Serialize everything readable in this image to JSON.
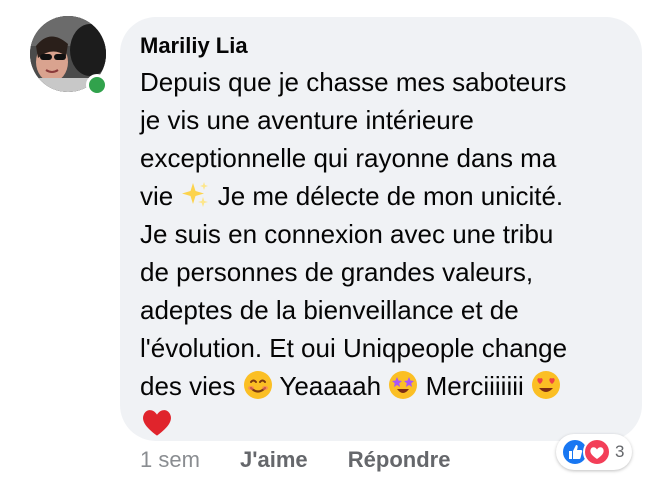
{
  "comment": {
    "author": "Mariliy Lia",
    "text_lines": [
      "Depuis que je chasse mes saboteurs",
      "je vis une aventure intérieure",
      "exceptionnelle qui rayonne dans ma",
      "vie",
      "Je me délecte de mon unicité.",
      "Je suis en connexion avec une tribu",
      "de personnes de grandes valeurs,",
      "adeptes de la bienveillance et de",
      "l'évolution. Et oui Uniqpeople change",
      "des vies",
      "Yeaaaah",
      "Merciiiiiii"
    ],
    "emojis": [
      "sparkles-emoji",
      "smiling-face-emoji",
      "star-struck-emoji",
      "heart-eyes-emoji",
      "red-heart-emoji"
    ],
    "online": true
  },
  "actions": {
    "time": "1 sem",
    "like": "J'aime",
    "reply": "Répondre"
  },
  "reactions": {
    "types": [
      "like-icon",
      "love-icon"
    ],
    "count": "3"
  },
  "colors": {
    "bubble": "#f0f2f5",
    "online": "#31a24c",
    "like_blue": "#1877f2",
    "love_red": "#f33e58",
    "secondary_text": "#65676b"
  }
}
